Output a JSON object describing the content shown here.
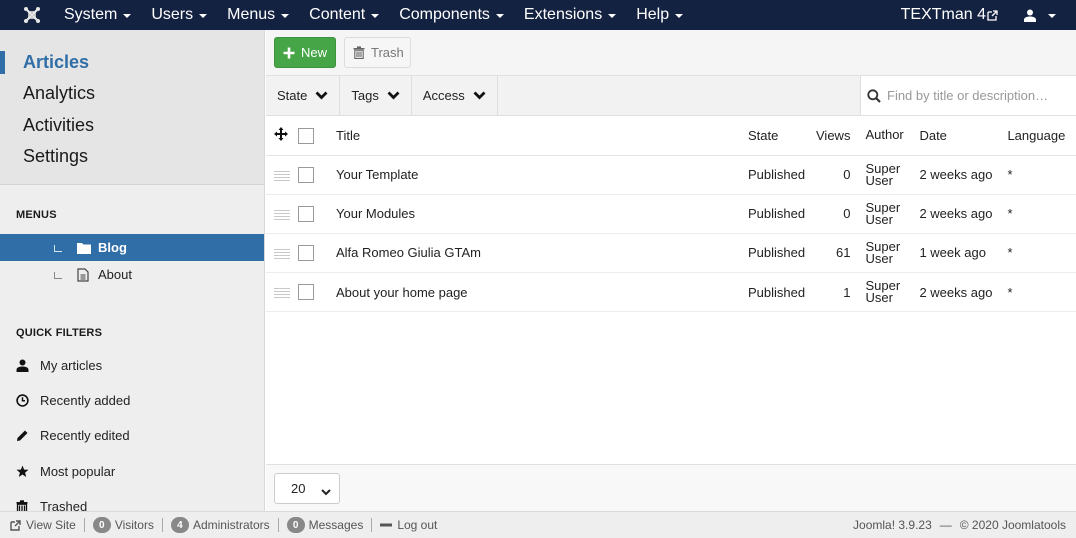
{
  "navbar": {
    "menus": [
      {
        "label": "System"
      },
      {
        "label": "Users"
      },
      {
        "label": "Menus"
      },
      {
        "label": "Content"
      },
      {
        "label": "Components"
      },
      {
        "label": "Extensions"
      },
      {
        "label": "Help"
      }
    ],
    "site_name": "TEXTman 4",
    "background": "#132241"
  },
  "sidebar": {
    "nav": [
      {
        "label": "Articles",
        "active": true
      },
      {
        "label": "Analytics"
      },
      {
        "label": "Activities"
      },
      {
        "label": "Settings"
      }
    ],
    "menus_heading": "MENUS",
    "menu_items": [
      {
        "label": "Blog",
        "icon": "folder-icon",
        "active": true
      },
      {
        "label": "About",
        "icon": "document-icon"
      }
    ],
    "quick_filters_heading": "QUICK FILTERS",
    "quick_filters": [
      {
        "label": "My articles",
        "icon": "user-icon"
      },
      {
        "label": "Recently added",
        "icon": "clock-icon"
      },
      {
        "label": "Recently edited",
        "icon": "pencil-icon"
      },
      {
        "label": "Most popular",
        "icon": "star-icon"
      },
      {
        "label": "Trashed",
        "icon": "trash-icon"
      }
    ],
    "accent": "#2f6ea7"
  },
  "toolbar": {
    "new_label": "New",
    "trash_label": "Trash",
    "new_color": "#46a546"
  },
  "filters": {
    "items": [
      {
        "label": "State"
      },
      {
        "label": "Tags"
      },
      {
        "label": "Access"
      }
    ],
    "search_placeholder": "Find by title or description…",
    "search_value": ""
  },
  "table": {
    "headers": {
      "title": "Title",
      "state": "State",
      "views": "Views",
      "author": "Author",
      "date": "Date",
      "language": "Language"
    },
    "rows": [
      {
        "title": "Your Template",
        "state": "Published",
        "views": "0",
        "author_first": "Super",
        "author_last": "User",
        "date": "2 weeks ago",
        "language": "*"
      },
      {
        "title": "Your Modules",
        "state": "Published",
        "views": "0",
        "author_first": "Super",
        "author_last": "User",
        "date": "2 weeks ago",
        "language": "*"
      },
      {
        "title": "Alfa Romeo Giulia GTAm",
        "state": "Published",
        "views": "61",
        "author_first": "Super",
        "author_last": "User",
        "date": "1 week ago",
        "language": "*"
      },
      {
        "title": "About your home page",
        "state": "Published",
        "views": "1",
        "author_first": "Super",
        "author_last": "User",
        "date": "2 weeks ago",
        "language": "*"
      }
    ]
  },
  "pager": {
    "limit": "20"
  },
  "statusbar": {
    "view_site": "View Site",
    "visitors_count": "0",
    "visitors_label": "Visitors",
    "admins_count": "4",
    "admins_label": "Administrators",
    "messages_count": "0",
    "messages_label": "Messages",
    "logout": "Log out",
    "version": "Joomla! 3.9.23",
    "dash": "—",
    "copyright": "© 2020 Joomlatools"
  }
}
